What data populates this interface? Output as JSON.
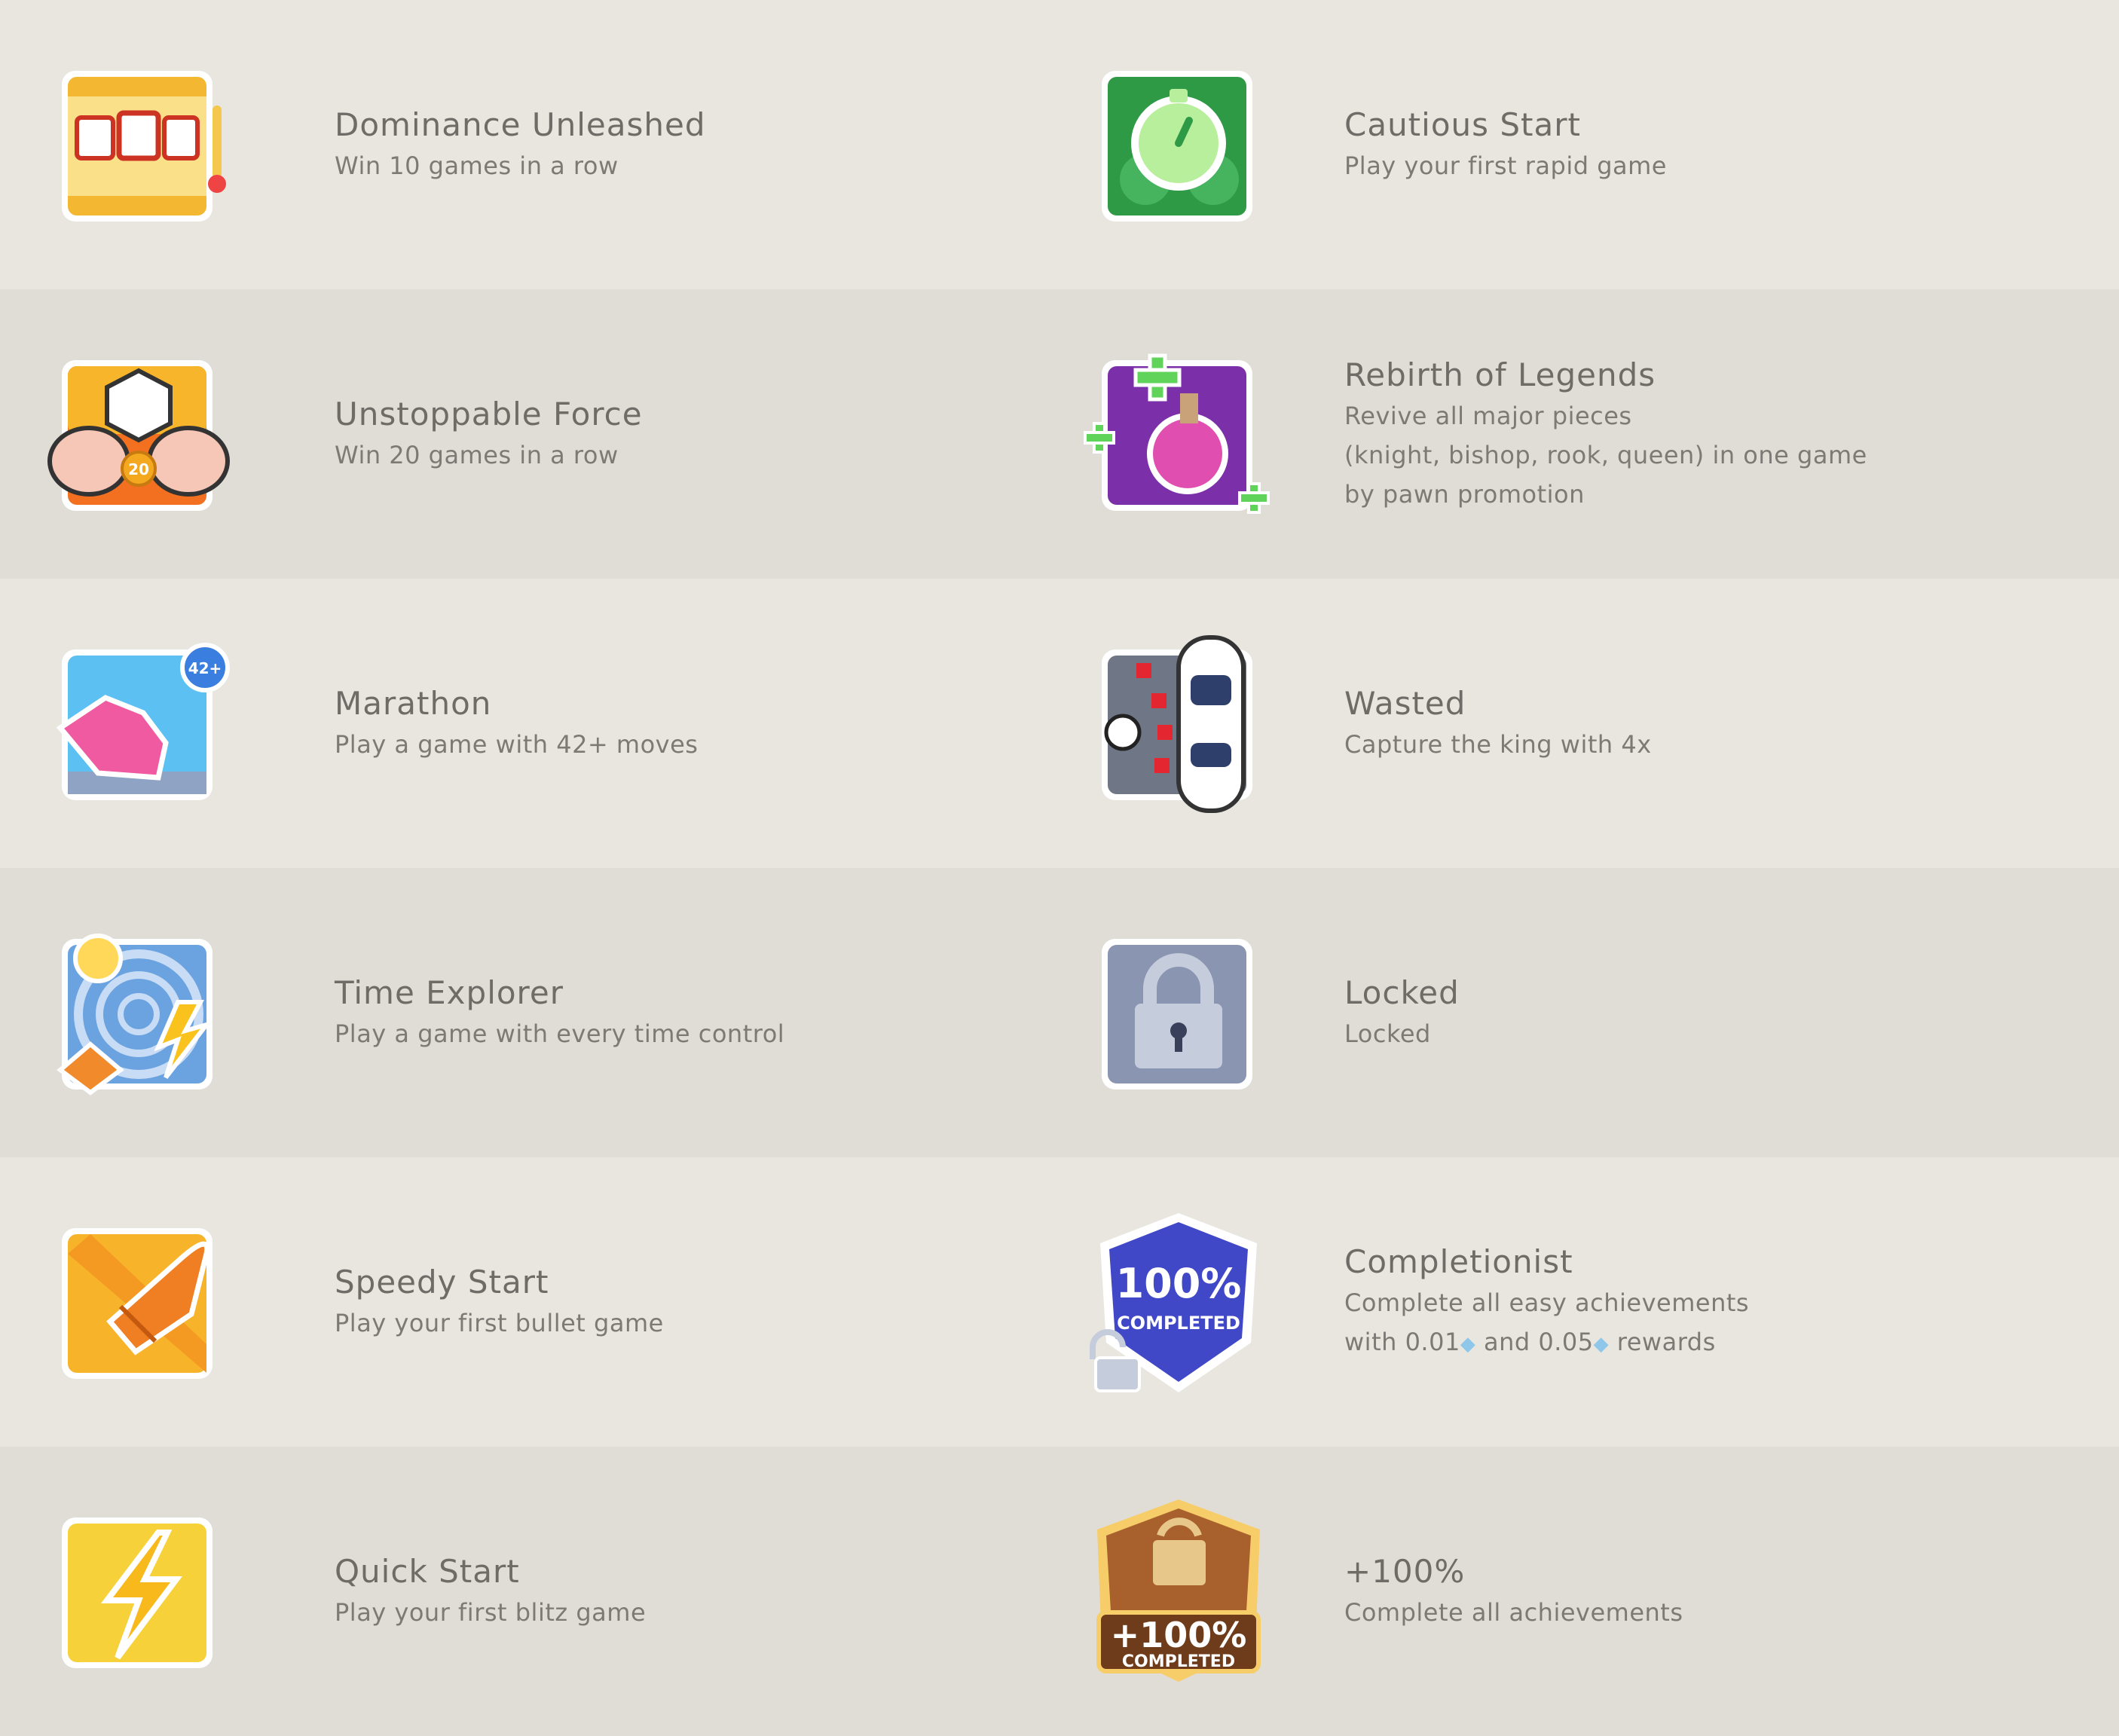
{
  "achievements": [
    [
      {
        "title": "Dominance Unleashed",
        "desc": [
          "Win 10 games in a row"
        ],
        "icon": "slot-machine-icon"
      },
      {
        "title": "Cautious Start",
        "desc": [
          "Play your first rapid game"
        ],
        "icon": "stopwatch-icon"
      }
    ],
    [
      {
        "title": "Unstoppable Force",
        "desc": [
          "Win 20 games in a row"
        ],
        "icon": "muscle-arms-icon",
        "badge_number": "20"
      },
      {
        "title": "Rebirth of Legends",
        "desc": [
          "Revive all major pieces",
          "(knight, bishop, rook, queen) in one game",
          "by pawn promotion"
        ],
        "icon": "potion-icon"
      }
    ],
    [
      {
        "title": "Marathon",
        "desc": [
          "Play a game with 42+ moves"
        ],
        "icon": "sneaker-icon",
        "badge_number": "42+"
      },
      {
        "title": "Wasted",
        "desc": [
          "Capture the king with 4x"
        ],
        "icon": "police-car-icon"
      }
    ],
    [
      {
        "title": "Time Explorer",
        "desc": [
          "Play a game with every time control"
        ],
        "icon": "time-vortex-icon"
      },
      {
        "title": "Locked",
        "desc": [
          "Locked"
        ],
        "icon": "padlock-icon"
      }
    ],
    [
      {
        "title": "Speedy Start",
        "desc": [
          "Play your first bullet game"
        ],
        "icon": "bullet-icon"
      },
      {
        "title": "Completionist",
        "desc": [
          "Complete all easy achievements",
          "with 0.01",
          " and 0.05",
          " rewards"
        ],
        "icon": "completed-shield-icon",
        "badge_text": [
          "100%",
          "COMPLETED"
        ]
      }
    ],
    [
      {
        "title": "Quick Start",
        "desc": [
          "Play your first blitz game"
        ],
        "icon": "lightning-icon"
      },
      {
        "title": "+100%",
        "desc": [
          "Complete all achievements"
        ],
        "icon": "gold-completed-icon",
        "badge_text": [
          "+100%",
          "COMPLETED"
        ]
      }
    ]
  ],
  "colors": {
    "row_light": "#e9e6e0",
    "row_dark": "#e0ddd7",
    "title": "#6f6c68",
    "desc": "#7d7a76",
    "gem": "#8fc7ea"
  },
  "gem_icon": "diamond-icon"
}
